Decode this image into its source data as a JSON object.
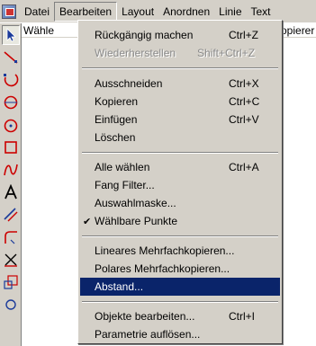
{
  "menubar": {
    "items": [
      "Datei",
      "Bearbeiten",
      "Layout",
      "Anordnen",
      "Linie",
      "Text"
    ]
  },
  "status": {
    "left_text": "Wähle",
    "right_text": "opierer"
  },
  "menu": {
    "groups": [
      [
        {
          "label": "Rückgängig machen",
          "shortcut": "Ctrl+Z"
        },
        {
          "label": "Wiederherstellen",
          "shortcut": "Shift+Ctrl+Z",
          "disabled": true
        }
      ],
      [
        {
          "label": "Ausschneiden",
          "shortcut": "Ctrl+X"
        },
        {
          "label": "Kopieren",
          "shortcut": "Ctrl+C"
        },
        {
          "label": "Einfügen",
          "shortcut": "Ctrl+V"
        },
        {
          "label": "Löschen",
          "shortcut": ""
        }
      ],
      [
        {
          "label": "Alle wählen",
          "shortcut": "Ctrl+A"
        },
        {
          "label": "Fang Filter...",
          "shortcut": ""
        },
        {
          "label": "Auswahlmaske...",
          "shortcut": ""
        },
        {
          "label": "Wählbare Punkte",
          "shortcut": "",
          "checked": true,
          "check_mark": "✔"
        }
      ],
      [
        {
          "label": "Lineares Mehrfachkopieren...",
          "shortcut": ""
        },
        {
          "label": "Polares Mehrfachkopieren...",
          "shortcut": ""
        },
        {
          "label": "Abstand...",
          "shortcut": "",
          "highlighted": true
        }
      ],
      [
        {
          "label": "Objekte bearbeiten...",
          "shortcut": "Ctrl+I"
        },
        {
          "label": "Parametrie auflösen...",
          "shortcut": ""
        }
      ]
    ]
  },
  "toolbar": {
    "tools": [
      "select-arrow-icon",
      "line-icon",
      "arc-icon",
      "circle-icon",
      "ellipse-icon",
      "rectangle-icon",
      "curve-icon",
      "text-icon",
      "measure-icon",
      "fillet-icon",
      "cross-icon",
      "group-icon",
      "more-icon"
    ]
  },
  "colors": {
    "menu_bg": "#d4d0c8",
    "highlight": "#0a246a",
    "tool_red": "#cc0000",
    "tool_blue": "#1a3a9a"
  }
}
